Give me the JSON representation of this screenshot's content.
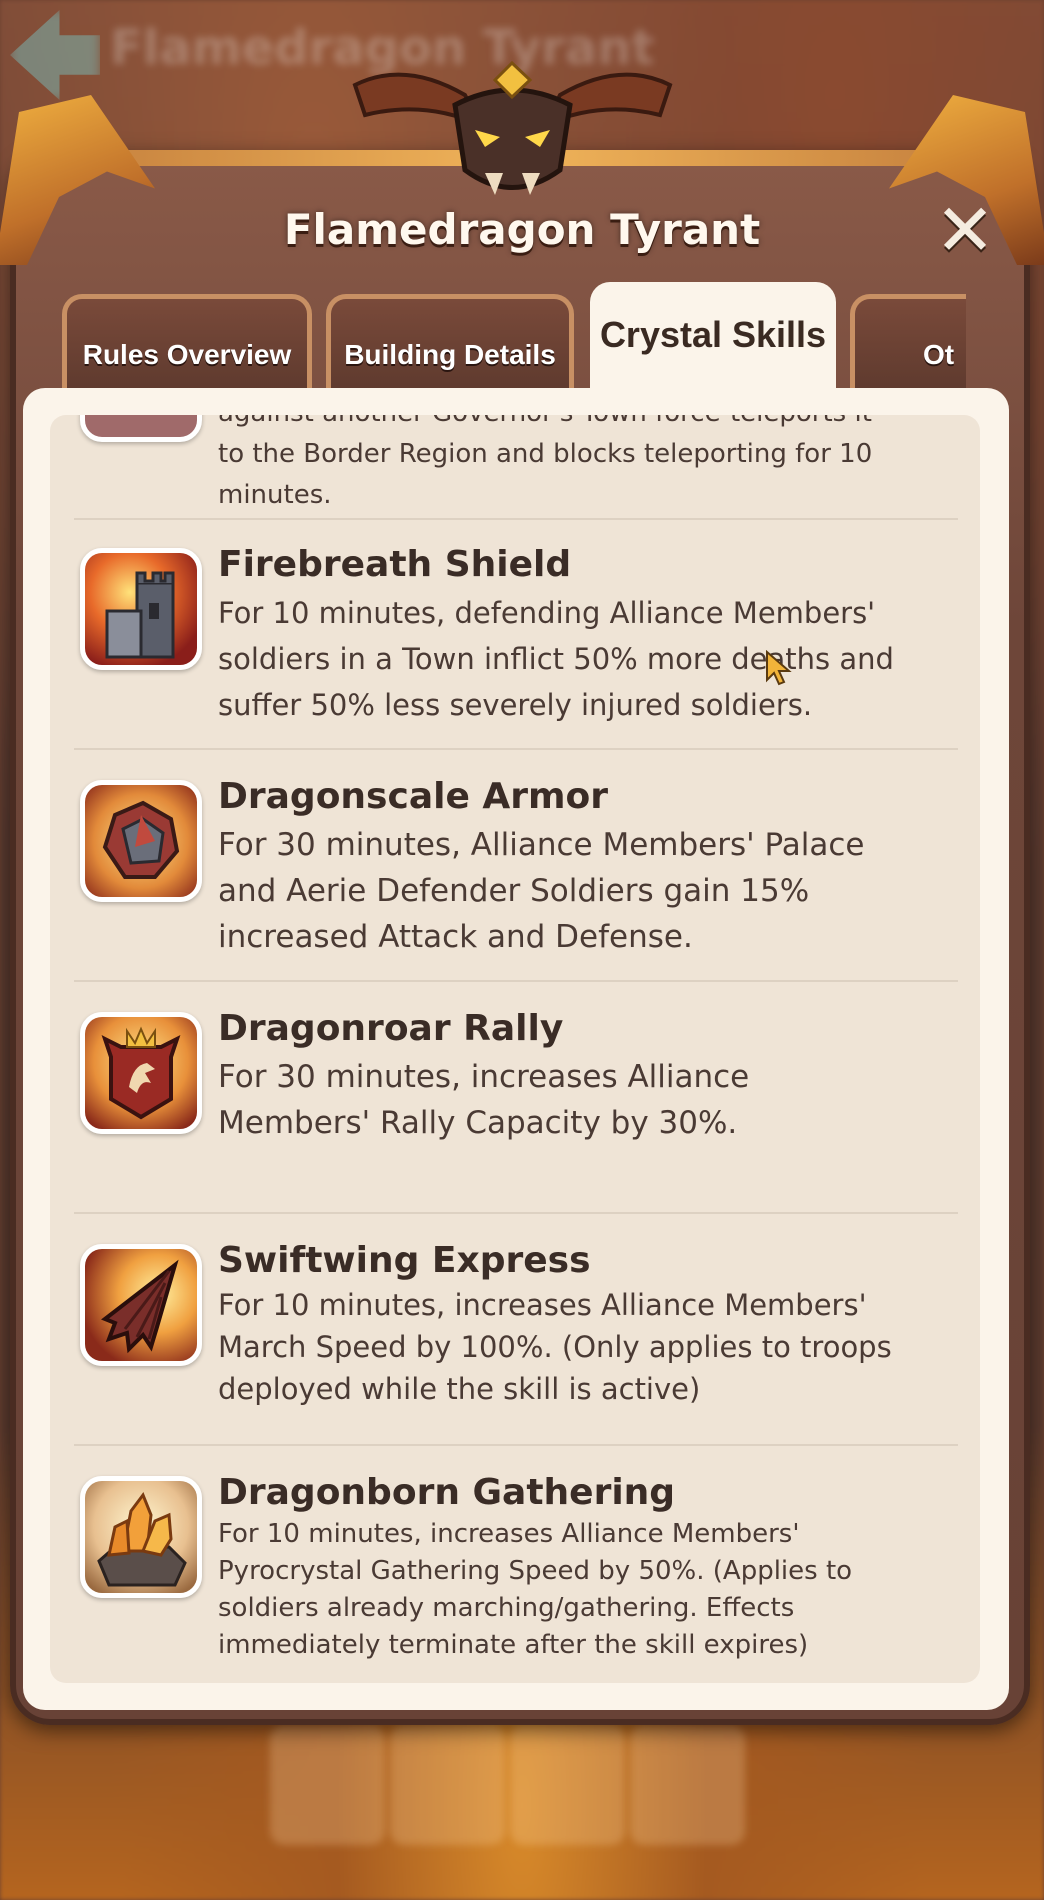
{
  "background": {
    "title": "Flamedragon Tyrant"
  },
  "dialog": {
    "title": "Flamedragon Tyrant",
    "close_label": "✕"
  },
  "tabs": [
    {
      "label": "Rules Overview",
      "active": false
    },
    {
      "label": "Building Details",
      "active": false
    },
    {
      "label": "Crystal Skills",
      "active": true
    },
    {
      "label": "Ot",
      "active": false
    }
  ],
  "skills": {
    "partial_top": {
      "desc": "against another Governor's Town force-teleports it\nto the Border Region and blocks teleporting for 10\nminutes."
    },
    "firebreath": {
      "name": "Firebreath Shield",
      "desc": "For 10 minutes, defending Alliance Members'\nsoldiers in a Town inflict 50% more deaths and\nsuffer 50% less severely injured soldiers.",
      "icon": "tower-icon"
    },
    "dragonscale": {
      "name": "Dragonscale Armor",
      "desc": "For 30 minutes, Alliance Members' Palace\nand Aerie Defender Soldiers gain 15%\nincreased Attack and Defense.",
      "icon": "armor-icon"
    },
    "dragonroar": {
      "name": "Dragonroar Rally",
      "desc": "For 30 minutes, increases Alliance\nMembers' Rally Capacity by 30%.",
      "icon": "dragon-banner-icon"
    },
    "swiftwing": {
      "name": "Swiftwing Express",
      "desc": "For 10 minutes, increases Alliance Members'\nMarch Speed by 100%. (Only applies to troops\ndeployed while the skill is active)",
      "icon": "wing-icon"
    },
    "dragonborn": {
      "name": "Dragonborn Gathering",
      "desc": "For 10 minutes, increases Alliance Members'\nPyrocrystal Gathering Speed by 50%. (Applies to\nsoldiers already marching/gathering. Effects\nimmediately terminate after the skill expires)",
      "icon": "crystal-icon"
    }
  },
  "colors": {
    "panel": "#fbf4ea",
    "panel_inner": "#efe4d6",
    "text_dark": "#3a2c26",
    "frame": "#6e4639",
    "tab_border": "#c89064"
  }
}
